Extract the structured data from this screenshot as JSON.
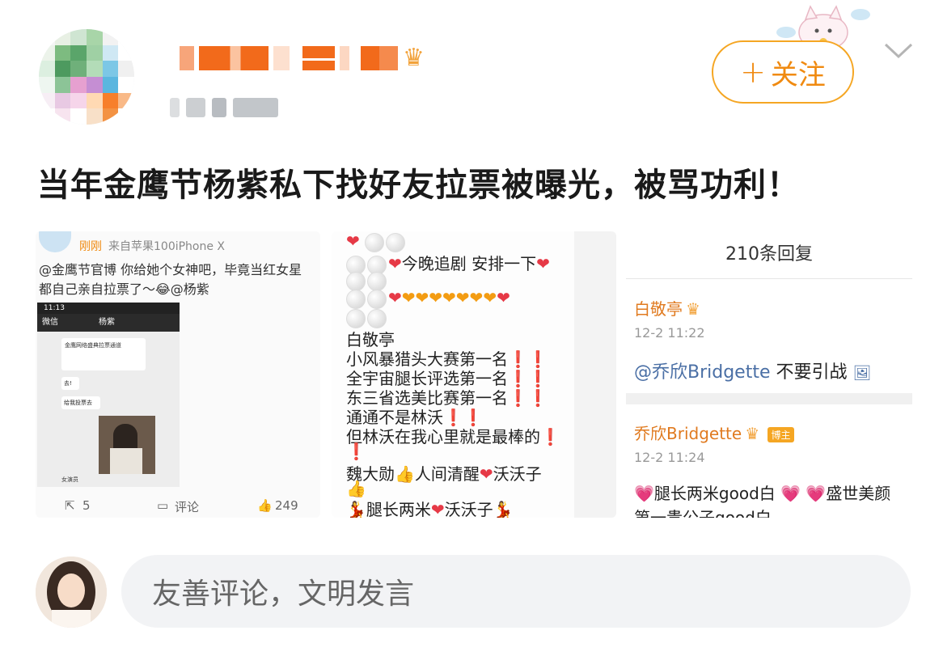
{
  "post": {
    "follow_label": "关注",
    "follow_plus": "+",
    "title": "当年金鹰节杨紫私下找好友拉票被曝光，被骂功利！",
    "username_visible": ".高y  en"
  },
  "image1": {
    "time": "刚刚",
    "source": "来自苹果100iPhone X",
    "text_line1": "@金鹰节官博 你给她个女神吧，毕竟当红女星",
    "text_line2": "都自己亲自拉票了～😂@杨紫",
    "phone_status": "11:13",
    "chat_back": "微信",
    "chat_title": "杨紫",
    "chat_msg1": "金鹰网络盛典拉票通道",
    "chat_msg2": "去!",
    "chat_msg3": "给我投票去",
    "chat_msg4": "女演员",
    "repost_count": "5",
    "comment_label": "评论",
    "like_count": "249"
  },
  "image2": {
    "line_a": "今晚追剧 安排一下",
    "line_name": "白敬亭",
    "line1": "小风暴猎头大赛第一名",
    "line2": "全宇宙腿长评选第一名",
    "line3": "东三省选美比赛第一名",
    "line4": "通通不是林沃",
    "line5": "但林沃在我心里就是最棒的",
    "line6": "魏大勋",
    "line6b": "人间清醒",
    "line6c": "沃沃子",
    "line7": "腿长两米",
    "line7b": "沃沃子"
  },
  "image3": {
    "replies_header": "210条回复",
    "c1_user": "白敬亭",
    "c1_time": "12-2 11:22",
    "c1_text_mention": "@乔欣Bridgette",
    "c1_text": "不要引战",
    "c2_user": "乔欣Bridgette",
    "c2_badge": "博主",
    "c2_time": "12-2 11:24",
    "c2_text": "腿长两米good白",
    "c2_text2": "盛世美颜",
    "c2_text3": "第一贵公子good白"
  },
  "comment_bar": {
    "placeholder": "友善评论，文明发言"
  },
  "colors": {
    "accent": "#f08a10",
    "follow_border": "#f5a623",
    "mention_blue": "#4a6fa5",
    "username_orange": "#f26a1b",
    "heart_red": "#e63946"
  },
  "icons": [
    "crown-icon",
    "chevron-down-icon",
    "plus-icon",
    "heart-icon",
    "repost-icon",
    "comment-icon",
    "like-icon"
  ]
}
